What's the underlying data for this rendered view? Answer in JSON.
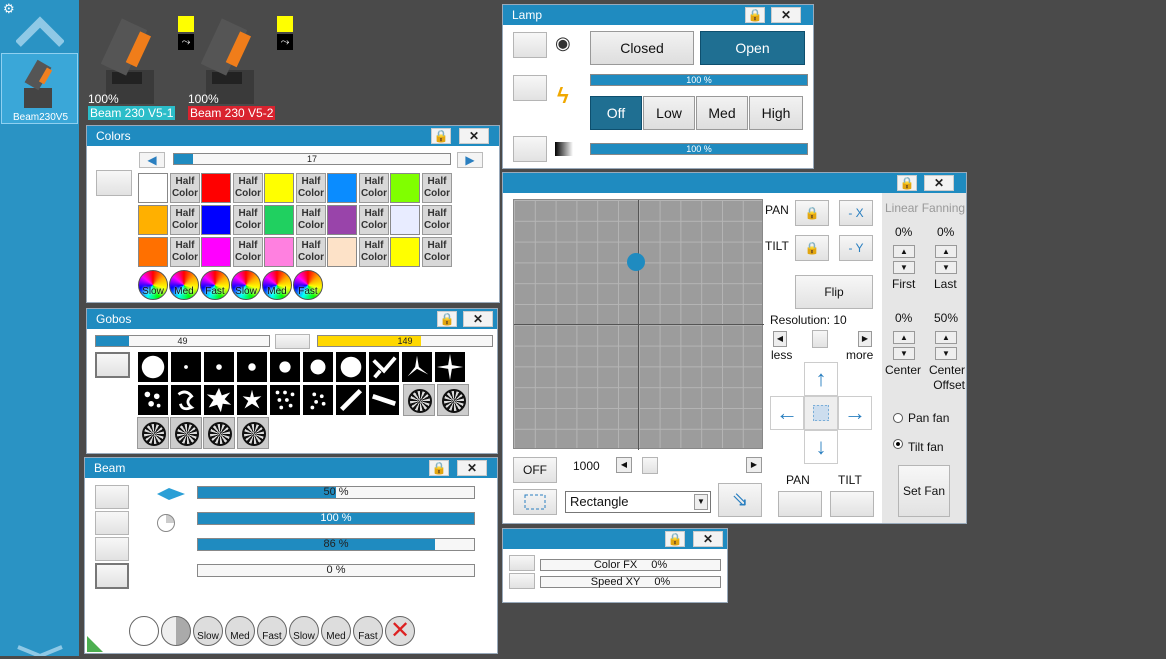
{
  "sidebar": {
    "fixture_label": "Beam230V5"
  },
  "fixtures": [
    {
      "label": "Beam 230 V5-1",
      "dimmer": "100%",
      "color": "#2bbdc9"
    },
    {
      "label": "Beam 230 V5-2",
      "dimmer": "100%",
      "color": "#d9232f"
    }
  ],
  "lamp": {
    "title": "Lamp",
    "closed": "Closed",
    "open": "Open",
    "bar1": "100 %",
    "off": "Off",
    "low": "Low",
    "med": "Med",
    "high": "High",
    "bar2": "100 %"
  },
  "colors": {
    "title": "Colors",
    "scroll_value": "17",
    "half": "Half",
    "color_word": "Color",
    "fx_labels": [
      "Slow",
      "Med",
      "Fast",
      "Slow",
      "Med",
      "Fast"
    ]
  },
  "gobos": {
    "title": "Gobos",
    "bar1": "49",
    "bar2": "149"
  },
  "beam": {
    "title": "Beam",
    "zoom": "50 %",
    "focus": "100 %",
    "frost": "86 %",
    "prism": "0 %",
    "speeds": [
      "Slow",
      "Med",
      "Fast",
      "Slow",
      "Med",
      "Fast"
    ]
  },
  "position": {
    "pan": "PAN",
    "tilt": "TILT",
    "neg_x": "- X",
    "neg_y": "- Y",
    "flip": "Flip",
    "resolution": "Resolution: 10",
    "less": "less",
    "more": "more",
    "off": "OFF",
    "speed_value": "1000",
    "shape": "Rectangle",
    "pan_label": "PAN",
    "tilt_label": "TILT",
    "linear_fanning": "Linear Fanning",
    "fan_first_pct": "0%",
    "fan_last_pct": "0%",
    "first": "First",
    "last": "Last",
    "center_pct": "0%",
    "offset_pct": "50%",
    "center": "Center",
    "center_offset": "Center Offset",
    "pan_fan": "Pan fan",
    "tilt_fan": "Tilt fan",
    "set_fan": "Set Fan"
  },
  "fx": {
    "color_fx": "Color FX",
    "color_fx_val": "0%",
    "speed_xy": "Speed XY",
    "speed_xy_val": "0%"
  },
  "colors_palette": {
    "row1": [
      "#ffffff",
      "#ff0000",
      "#ffff00",
      "#0a8cff",
      "#80ff00"
    ],
    "row2": [
      "#ffb000",
      "#0000ff",
      "#20d060",
      "#9944aa",
      "#e8ecff"
    ],
    "row3": [
      "#ff7000",
      "#ff00ff",
      "#ff80e0",
      "#fde2c8",
      "#ffff00"
    ]
  }
}
